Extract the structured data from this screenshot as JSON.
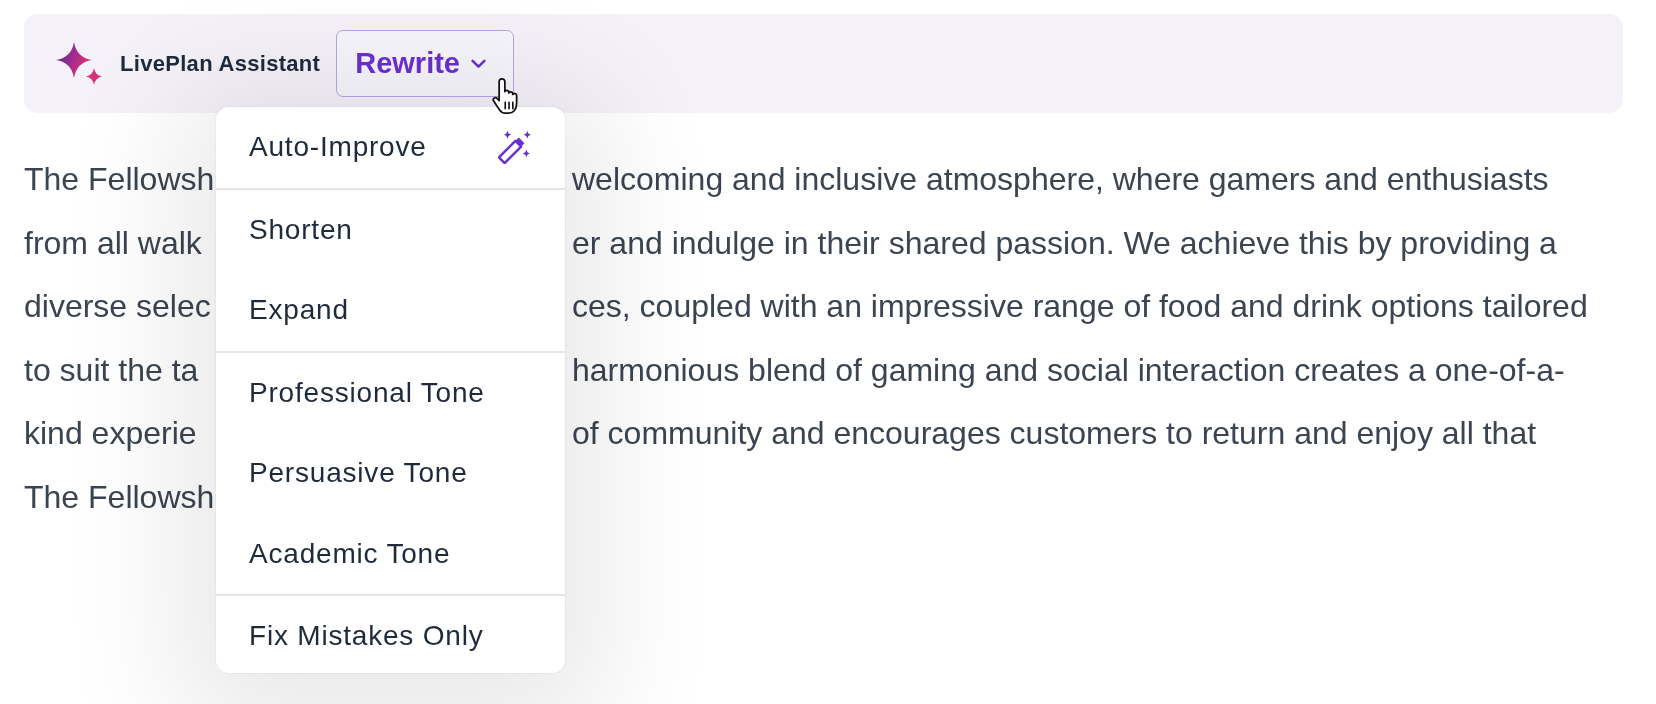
{
  "toolbar": {
    "title": "LivePlan Assistant",
    "menu_button": {
      "label": "Rewrite",
      "expanded": true
    }
  },
  "menu": {
    "groups": [
      {
        "items": [
          {
            "label": "Auto-Improve",
            "kind": "magic"
          }
        ]
      },
      {
        "items": [
          {
            "label": "Shorten",
            "kind": "plain"
          },
          {
            "label": "Expand",
            "kind": "plain"
          }
        ]
      },
      {
        "items": [
          {
            "label": "Professional Tone",
            "kind": "plain"
          },
          {
            "label": "Persuasive Tone",
            "kind": "plain"
          },
          {
            "label": "Academic Tone",
            "kind": "plain"
          }
        ]
      },
      {
        "items": [
          {
            "label": "Fix Mistakes Only",
            "kind": "plain"
          }
        ]
      }
    ]
  },
  "paragraph": {
    "lines": [
      {
        "left": "The Fellowsh",
        "right": "welcoming and inclusive atmosphere, where gamers and enthusiasts"
      },
      {
        "left": "from all walk",
        "right": "er and indulge in their shared passion. We achieve this by providing a"
      },
      {
        "left": "diverse selec",
        "right": "ces, coupled with an impressive range of food and drink options tailored"
      },
      {
        "left": "to suit the ta",
        "right": "harmonious blend of gaming and social interaction creates a one-of-a-"
      },
      {
        "left": "kind experie",
        "right": "of community and encourages customers to return and enjoy all that"
      },
      {
        "left": "The Fellowsh"
      }
    ]
  }
}
